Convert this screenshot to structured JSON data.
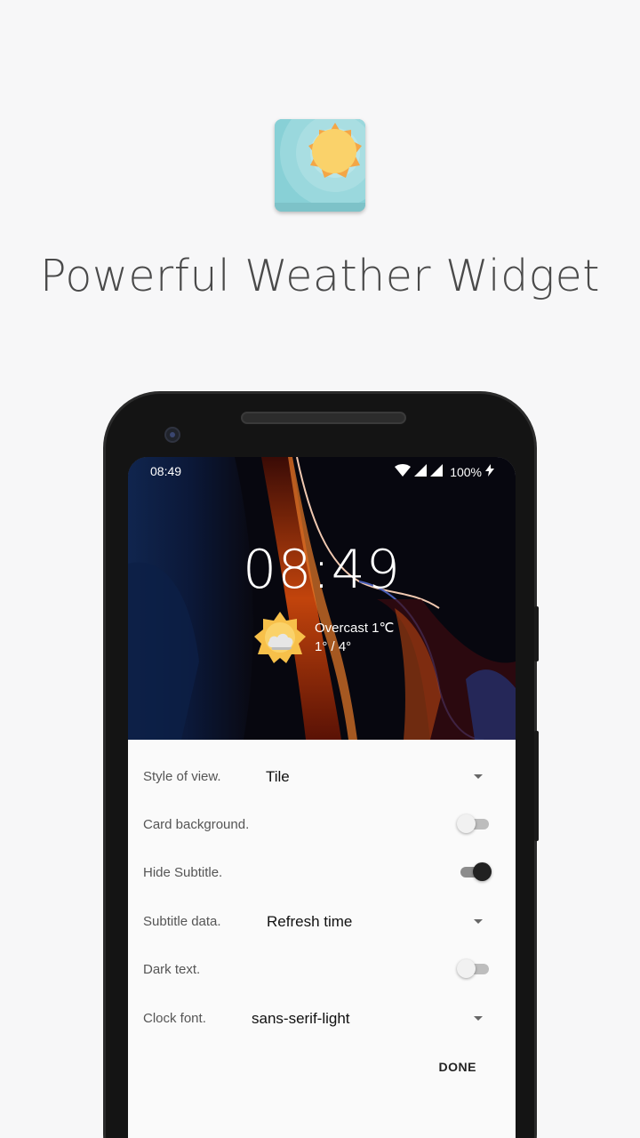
{
  "headline": "Powerful Weather Widget",
  "status_bar": {
    "time": "08:49",
    "battery": "100%",
    "icons": [
      "wifi-icon",
      "signal-icon",
      "signal-icon",
      "charging-icon"
    ]
  },
  "widget": {
    "clock": "08:49",
    "condition": "Overcast 1℃",
    "range": "1° / 4°",
    "weather_icon": "sun-cloud-icon"
  },
  "settings": {
    "style_of_view": {
      "label": "Style of view.",
      "value": "Tile"
    },
    "card_background": {
      "label": "Card background.",
      "on": false
    },
    "hide_subtitle": {
      "label": "Hide Subtitle.",
      "on": true
    },
    "subtitle_data": {
      "label": "Subtitle data.",
      "value": "Refresh time"
    },
    "dark_text": {
      "label": "Dark text.",
      "on": false
    },
    "clock_font": {
      "label": "Clock font.",
      "value": "sans-serif-light"
    }
  },
  "done_label": "DONE",
  "colors": {
    "background": "#f7f7f8",
    "phone_body": "#141414",
    "icon_teal": "#88d0d6",
    "sun": "#f7c04a",
    "toggle_on_thumb": "#212121"
  }
}
